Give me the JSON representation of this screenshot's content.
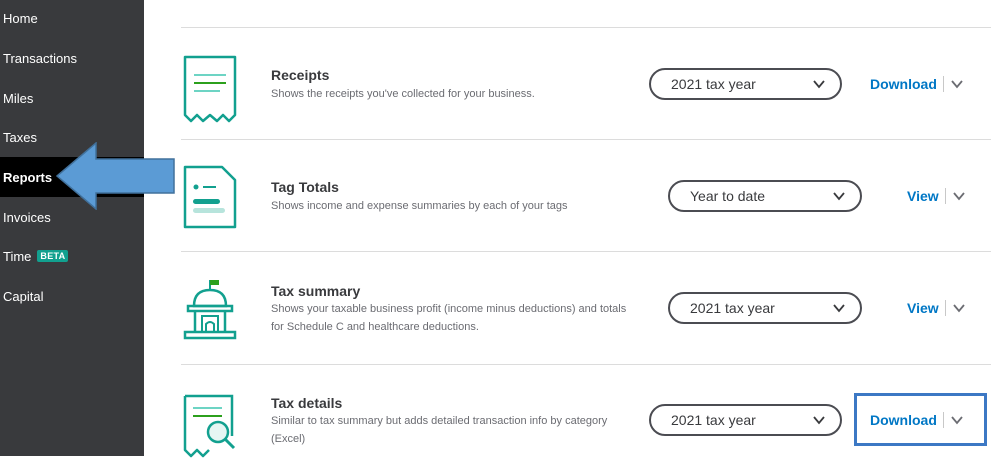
{
  "sidebar": {
    "items": [
      {
        "label": "Home"
      },
      {
        "label": "Transactions"
      },
      {
        "label": "Miles"
      },
      {
        "label": "Taxes"
      },
      {
        "label": "Reports"
      },
      {
        "label": "Invoices"
      },
      {
        "label": "Time",
        "badge": "BETA"
      },
      {
        "label": "Capital"
      }
    ],
    "active_item": "Reports"
  },
  "reports": [
    {
      "title": "Receipts",
      "description": "Shows the receipts you've collected for your business.",
      "period": "2021 tax year",
      "action": "Download",
      "icon": "receipt-icon"
    },
    {
      "title": "Tag Totals",
      "description": "Shows income and expense summaries by each of your tags",
      "period": "Year to date",
      "action": "View",
      "icon": "tag-report-icon"
    },
    {
      "title": "Tax summary",
      "description": "Shows your taxable business profit (income minus deductions) and totals for Schedule C and healthcare deductions.",
      "period": "2021 tax year",
      "action": "View",
      "icon": "capitol-building-icon"
    },
    {
      "title": "Tax details",
      "description": "Similar to tax summary but adds detailed transaction info by category (Excel)",
      "period": "2021 tax year",
      "action": "Download",
      "icon": "magnifier-document-icon"
    }
  ],
  "colors": {
    "accent": "#0077c5",
    "icon_teal": "#12a08f",
    "sidebar_bg": "#393a3d",
    "annotation_blue": "#5b9bd5"
  }
}
